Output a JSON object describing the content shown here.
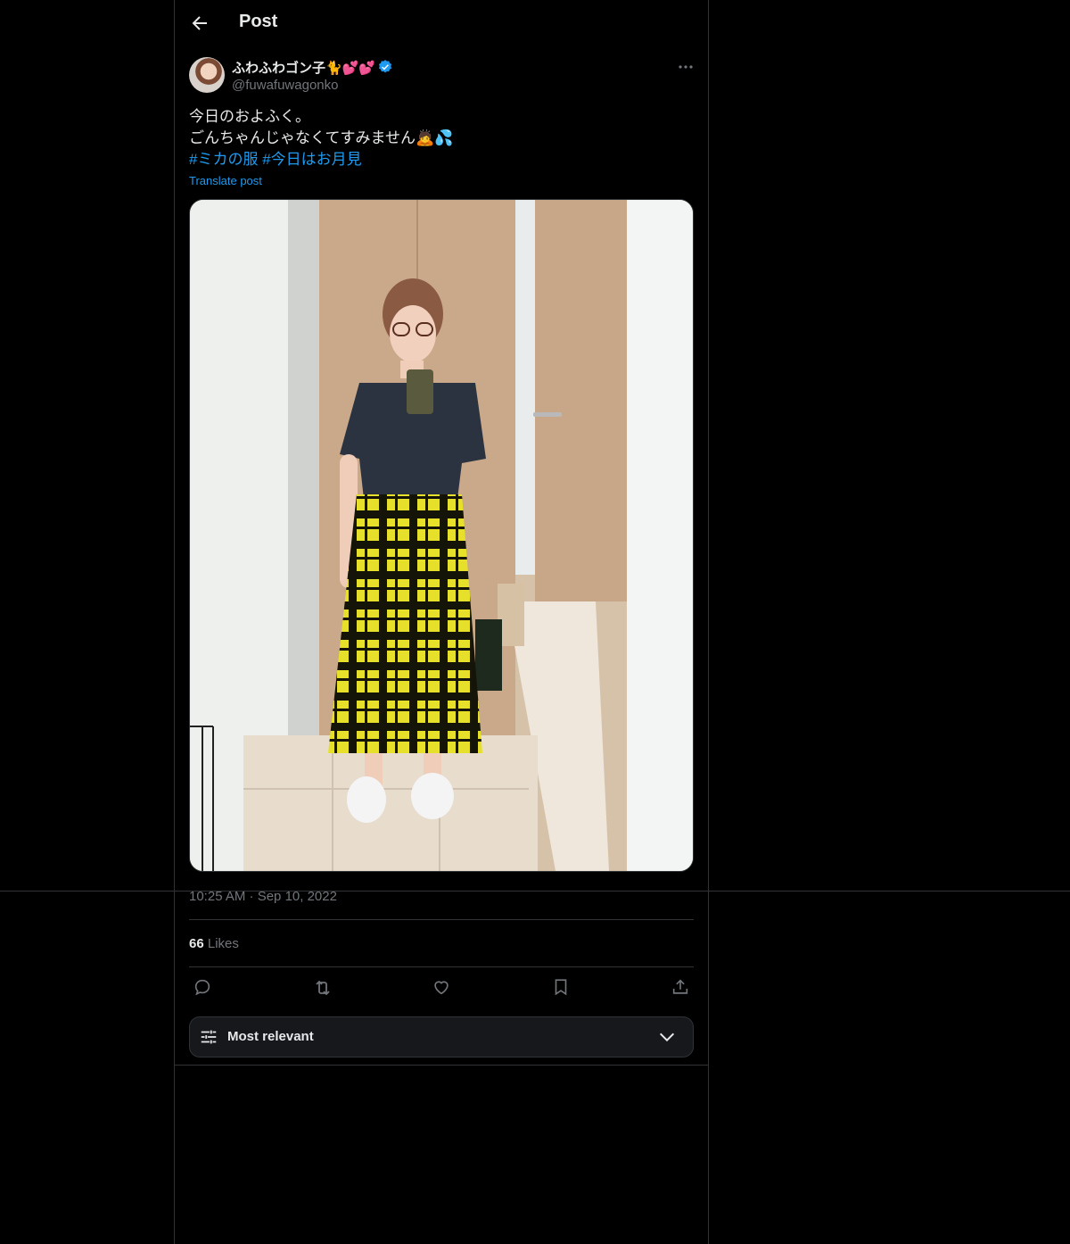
{
  "header": {
    "title": "Post"
  },
  "post": {
    "author_name": "ふわふわゴン子🐈💕💕",
    "author_handle": "@fuwafuwagonko",
    "text_line1": "今日のおよふく。",
    "text_line2": "ごんちゃんじゃなくてすみません🙇💦",
    "hashtag1": "#ミカの服",
    "hashtag2": "#今日はお月見",
    "translate_label": "Translate post",
    "timestamp": "10:25 AM · Sep 10, 2022",
    "likes_count": "66",
    "likes_label": "Likes"
  },
  "icons": {
    "back": "arrow-left-icon",
    "more": "more-dots-icon",
    "verified": "verified-badge-icon",
    "reply": "reply-icon",
    "repost": "repost-icon",
    "like": "heart-icon",
    "bookmark": "bookmark-icon",
    "share": "share-icon",
    "sort": "sliders-icon",
    "chevron": "chevron-down-icon"
  },
  "sort": {
    "label": "Most relevant"
  },
  "colors": {
    "background": "#000000",
    "text": "#e7e9ea",
    "muted": "#71767b",
    "accent": "#1d9bf0",
    "border": "#2f3336"
  }
}
